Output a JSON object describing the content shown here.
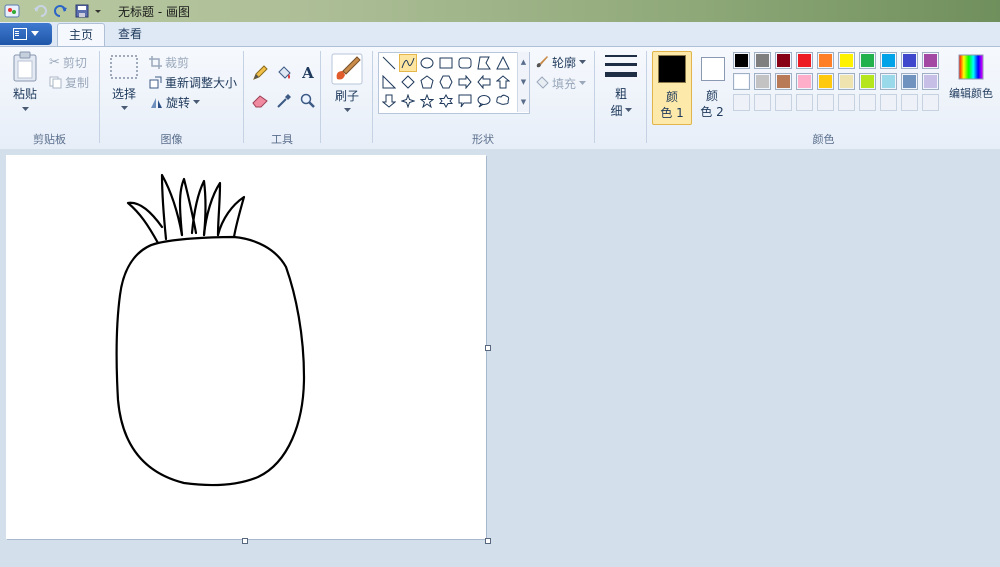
{
  "window": {
    "title": "无标题 - 画图"
  },
  "tabs": [
    {
      "label": "主页"
    },
    {
      "label": "查看"
    }
  ],
  "clipboard": {
    "paste_label": "粘贴",
    "cut_label": "剪切",
    "copy_label": "复制",
    "group_label": "剪贴板"
  },
  "image": {
    "select_label": "选择",
    "crop_label": "裁剪",
    "resize_label": "重新调整大小",
    "rotate_label": "旋转",
    "group_label": "图像"
  },
  "tools": {
    "group_label": "工具",
    "items": [
      "pencil-icon",
      "fill-bucket-icon",
      "text-icon",
      "eraser-icon",
      "color-picker-icon",
      "magnifier-icon"
    ]
  },
  "brush": {
    "label": "刷子"
  },
  "shapes": {
    "group_label": "形状",
    "outline_label": "轮廓",
    "fill_label": "填充",
    "selected": "curve"
  },
  "size": {
    "label_line1": "粗",
    "label_line2": "细"
  },
  "colors": {
    "group_label": "颜色",
    "color1_line1": "颜",
    "color1_line2": "色 1",
    "color1_value": "#000000",
    "color2_line1": "颜",
    "color2_line2": "色 2",
    "color2_value": "#ffffff",
    "edit_label": "编辑颜色",
    "palette_row1": [
      "#000000",
      "#7f7f7f",
      "#880015",
      "#ed1c24",
      "#ff7f27",
      "#fff200",
      "#22b14c",
      "#00a2e8",
      "#3f48cc",
      "#a349a4"
    ],
    "palette_row2": [
      "#ffffff",
      "#c3c3c3",
      "#b97a57",
      "#ffaec9",
      "#ffc90e",
      "#efe4b0",
      "#b5e61d",
      "#99d9ea",
      "#7092be",
      "#c8bfe7"
    ]
  }
}
